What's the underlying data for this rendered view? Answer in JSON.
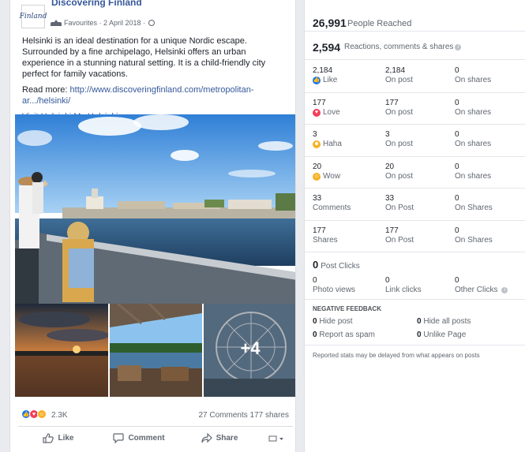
{
  "post": {
    "page_name": "Discovering Finland",
    "avatar_text": "Finland",
    "meta": "Favourites · 2 April 2018 ·",
    "text": "Helsinki is an ideal destination for a unique Nordic escape. Surrounded by a fine archipelago, Helsinki offers an urban experience in a stunning natural setting. It is a child-friendly city perfect for family vacations.",
    "read_more_label": "Read more:",
    "read_more_link": "http://www.discoveringfinland.com/metropolitan-ar.../helsinki/",
    "visit_link": "Visit Helsinki My Helsinki",
    "more_photos": "+4",
    "reaction_count": "2.3K",
    "comments_shares": "27 Comments  177 shares",
    "actions": {
      "like": "Like",
      "comment": "Comment",
      "share": "Share"
    }
  },
  "insights": {
    "people_reached": {
      "value": "26,991",
      "label": "People Reached"
    },
    "engagement": {
      "value": "2,594",
      "label": "Reactions, comments & shares"
    },
    "rows": [
      {
        "icon": "like-icon",
        "color": "#1877f2",
        "glyph": "👍",
        "total": "2,184",
        "total_label": "Like",
        "on_post": "2,184",
        "on_post_label": "On post",
        "on_shares": "0",
        "on_shares_label": "On shares"
      },
      {
        "icon": "love-icon",
        "color": "#f33e58",
        "glyph": "♥",
        "total": "177",
        "total_label": "Love",
        "on_post": "177",
        "on_post_label": "On post",
        "on_shares": "0",
        "on_shares_label": "On shares"
      },
      {
        "icon": "haha-icon",
        "color": "#f7b125",
        "glyph": "☻",
        "total": "3",
        "total_label": "Haha",
        "on_post": "3",
        "on_post_label": "On post",
        "on_shares": "0",
        "on_shares_label": "On shares"
      },
      {
        "icon": "wow-icon",
        "color": "#f7b125",
        "glyph": "☺",
        "total": "20",
        "total_label": "Wow",
        "on_post": "20",
        "on_post_label": "On post",
        "on_shares": "0",
        "on_shares_label": "On shares"
      },
      {
        "icon": "",
        "color": "",
        "glyph": "",
        "total": "33",
        "total_label": "Comments",
        "on_post": "33",
        "on_post_label": "On Post",
        "on_shares": "0",
        "on_shares_label": "On Shares"
      },
      {
        "icon": "",
        "color": "",
        "glyph": "",
        "total": "177",
        "total_label": "Shares",
        "on_post": "177",
        "on_post_label": "On Post",
        "on_shares": "0",
        "on_shares_label": "On Shares"
      }
    ],
    "post_clicks": {
      "value": "0",
      "label": "Post Clicks",
      "photo_views": "0",
      "photo_views_label": "Photo views",
      "link_clicks": "0",
      "link_clicks_label": "Link clicks",
      "other_clicks": "0",
      "other_clicks_label": "Other Clicks"
    },
    "negative": {
      "title": "NEGATIVE FEEDBACK",
      "hide_post": "0",
      "hide_post_label": "Hide post",
      "hide_all": "0",
      "hide_all_label": "Hide all posts",
      "spam": "0",
      "spam_label": "Report as spam",
      "unlike": "0",
      "unlike_label": "Unlike Page"
    },
    "note": "Reported stats may be delayed from what appears on posts"
  }
}
